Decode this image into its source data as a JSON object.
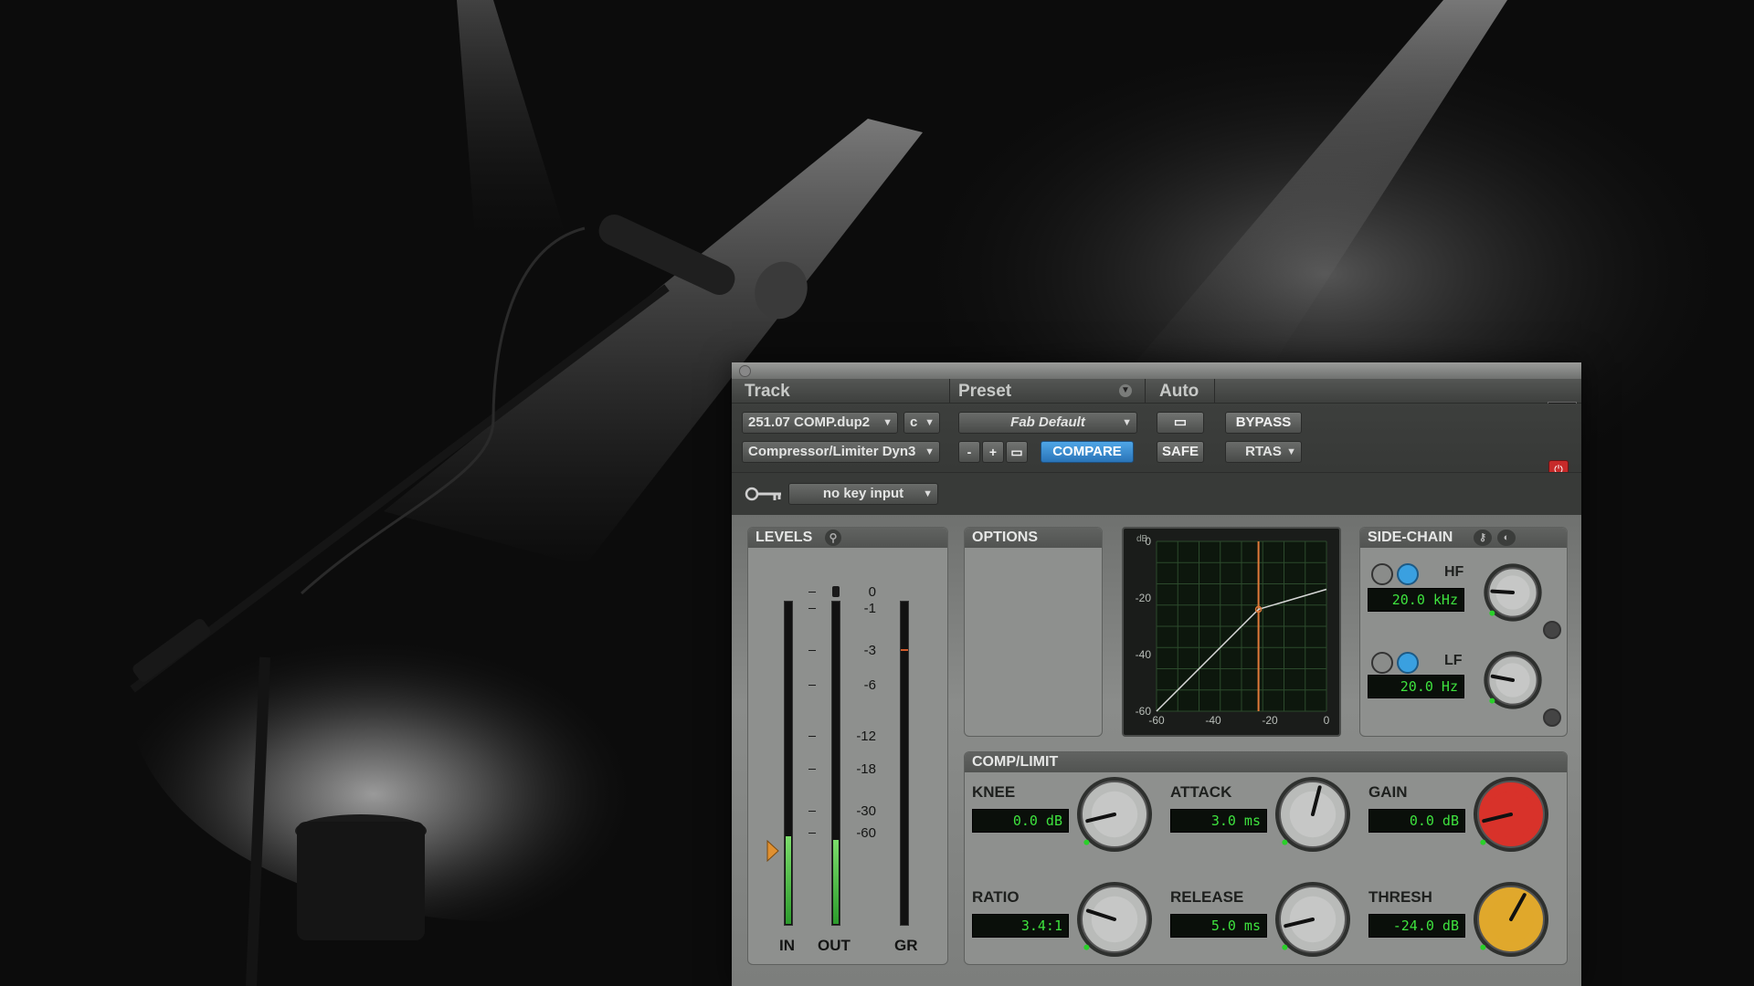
{
  "header": {
    "track_label": "Track",
    "preset_label": "Preset",
    "auto_label": "Auto"
  },
  "track": {
    "name": "251.07 COMP.dup2",
    "channel": "c",
    "plugin": "Compressor/Limiter Dyn3"
  },
  "preset": {
    "name": "Fab Default",
    "minus": "-",
    "plus": "+",
    "compare": "COMPARE"
  },
  "auto": {
    "bypass": "BYPASS",
    "safe": "SAFE",
    "rtas": "RTAS"
  },
  "key_input": {
    "value": "no key input"
  },
  "levels": {
    "title": "LEVELS",
    "scale": [
      "0",
      "-1",
      "-3",
      "-6",
      "-12",
      "-18",
      "-30",
      "-60"
    ],
    "in_label": "IN",
    "out_label": "OUT",
    "gr_label": "GR",
    "in_level": 0.27,
    "out_level": 0.26,
    "gr_level": 0.0
  },
  "options": {
    "title": "OPTIONS"
  },
  "graph": {
    "y_unit": "dB",
    "y_ticks": [
      "0",
      "-20",
      "-40",
      "-60"
    ],
    "x_ticks": [
      "-60",
      "-40",
      "-20",
      "0"
    ],
    "threshold_db": -24,
    "ratio": 3.4
  },
  "sidechain": {
    "title": "SIDE-CHAIN",
    "hf_label": "HF",
    "hf_value": "20.0 kHz",
    "lf_label": "LF",
    "lf_value": "20.0 Hz"
  },
  "comp": {
    "title": "COMP/LIMIT",
    "knee_label": "KNEE",
    "knee_value": "0.0 dB",
    "attack_label": "ATTACK",
    "attack_value": "3.0 ms",
    "gain_label": "GAIN",
    "gain_value": "0.0 dB",
    "ratio_label": "RATIO",
    "ratio_value": "3.4:1",
    "release_label": "RELEASE",
    "release_value": "5.0 ms",
    "thresh_label": "THRESH",
    "thresh_value": "-24.0 dB"
  },
  "colors": {
    "lcd_text": "#3ee23e",
    "compare_button": "#3b8fd6",
    "gain_knob": "#d8322a",
    "thresh_knob": "#e0a82c",
    "graph_threshold_line": "#e07a3a"
  }
}
